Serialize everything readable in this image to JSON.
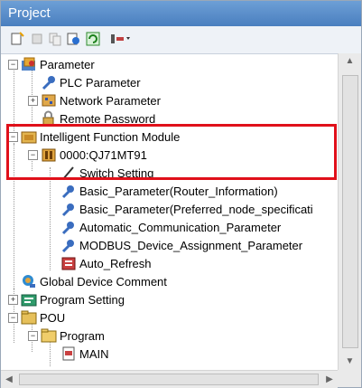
{
  "window": {
    "title": "Project"
  },
  "toolbar": {
    "icons": [
      "new-data-icon",
      "cut-icon",
      "copy-icon",
      "properties-icon",
      "refresh-icon",
      "settings-icon"
    ]
  },
  "tree": {
    "items": [
      {
        "label": "Parameter",
        "expander": "−"
      },
      {
        "label": "PLC Parameter"
      },
      {
        "label": "Network Parameter",
        "expander": "+"
      },
      {
        "label": "Remote Password"
      },
      {
        "label": "Intelligent Function Module",
        "expander": "−"
      },
      {
        "label": "0000:QJ71MT91",
        "expander": "−"
      },
      {
        "label": "Switch Setting"
      },
      {
        "label": "Basic_Parameter(Router_Information)"
      },
      {
        "label": "Basic_Parameter(Preferred_node_specificati"
      },
      {
        "label": "Automatic_Communication_Parameter"
      },
      {
        "label": "MODBUS_Device_Assignment_Parameter"
      },
      {
        "label": "Auto_Refresh"
      },
      {
        "label": "Global Device Comment"
      },
      {
        "label": "Program Setting",
        "expander": "+"
      },
      {
        "label": "POU",
        "expander": "−"
      },
      {
        "label": "Program",
        "expander": "−"
      },
      {
        "label": "MAIN"
      }
    ]
  },
  "colors": {
    "highlight": "#e0101a",
    "title_bar": "#5a8cc9"
  }
}
